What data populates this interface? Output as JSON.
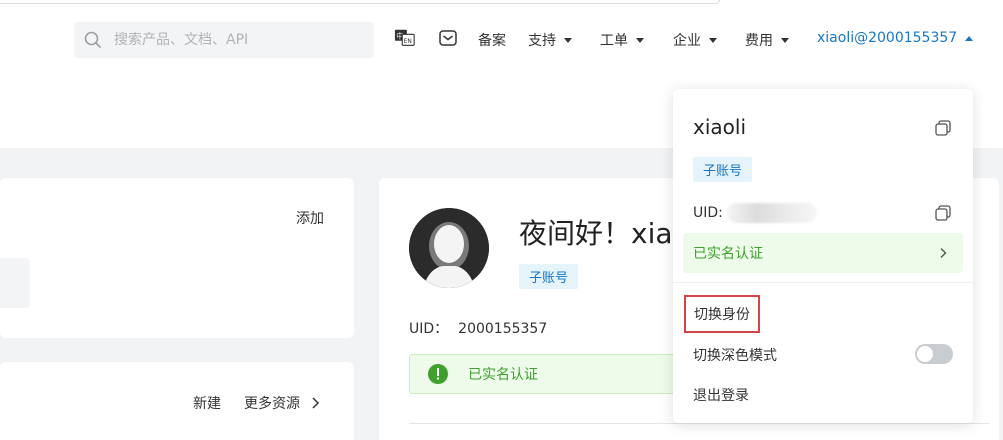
{
  "header": {
    "search_placeholder": "搜索产品、文档、API",
    "nav": {
      "record": "备案",
      "support": "支持",
      "ticket": "工单",
      "enterprise": "企业",
      "billing": "费用",
      "user": "xiaoli@2000155357"
    },
    "icons": [
      "search-icon",
      "language-switch-icon",
      "message-icon"
    ]
  },
  "left": {
    "card1_action": "添加",
    "card2_new": "新建",
    "card2_more": "更多资源"
  },
  "profile": {
    "greeting": "夜间好！xia",
    "role_tag": "子账号",
    "uid_label": "UID：",
    "uid_value": "2000155357",
    "verified": "已实名认证"
  },
  "dropdown": {
    "name": "xiaoli",
    "role_tag": "子账号",
    "uid_label": "UID:",
    "verified": "已实名认证",
    "switch_identity": "切换身份",
    "dark_mode": "切换深色模式",
    "dark_mode_on": false,
    "logout": "退出登录"
  },
  "colors": {
    "accent": "#1677c9",
    "success": "#3fa12c",
    "highlight_border": "#d64545"
  }
}
